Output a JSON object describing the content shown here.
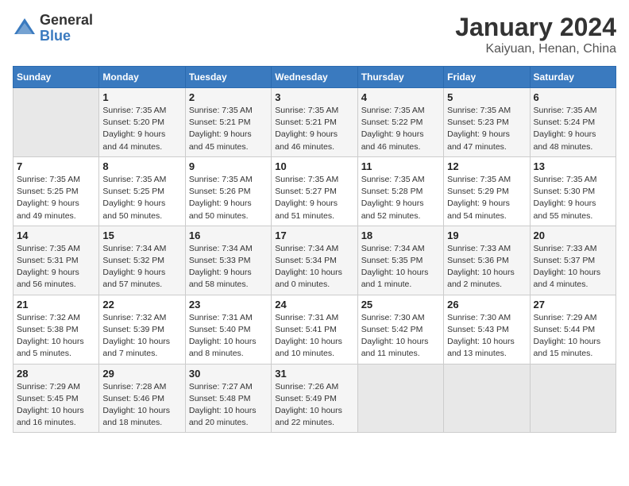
{
  "logo": {
    "general": "General",
    "blue": "Blue"
  },
  "title": "January 2024",
  "subtitle": "Kaiyuan, Henan, China",
  "days_header": [
    "Sunday",
    "Monday",
    "Tuesday",
    "Wednesday",
    "Thursday",
    "Friday",
    "Saturday"
  ],
  "weeks": [
    [
      {
        "num": "",
        "info": ""
      },
      {
        "num": "1",
        "info": "Sunrise: 7:35 AM\nSunset: 5:20 PM\nDaylight: 9 hours\nand 44 minutes."
      },
      {
        "num": "2",
        "info": "Sunrise: 7:35 AM\nSunset: 5:21 PM\nDaylight: 9 hours\nand 45 minutes."
      },
      {
        "num": "3",
        "info": "Sunrise: 7:35 AM\nSunset: 5:21 PM\nDaylight: 9 hours\nand 46 minutes."
      },
      {
        "num": "4",
        "info": "Sunrise: 7:35 AM\nSunset: 5:22 PM\nDaylight: 9 hours\nand 46 minutes."
      },
      {
        "num": "5",
        "info": "Sunrise: 7:35 AM\nSunset: 5:23 PM\nDaylight: 9 hours\nand 47 minutes."
      },
      {
        "num": "6",
        "info": "Sunrise: 7:35 AM\nSunset: 5:24 PM\nDaylight: 9 hours\nand 48 minutes."
      }
    ],
    [
      {
        "num": "7",
        "info": "Sunrise: 7:35 AM\nSunset: 5:25 PM\nDaylight: 9 hours\nand 49 minutes."
      },
      {
        "num": "8",
        "info": "Sunrise: 7:35 AM\nSunset: 5:25 PM\nDaylight: 9 hours\nand 50 minutes."
      },
      {
        "num": "9",
        "info": "Sunrise: 7:35 AM\nSunset: 5:26 PM\nDaylight: 9 hours\nand 50 minutes."
      },
      {
        "num": "10",
        "info": "Sunrise: 7:35 AM\nSunset: 5:27 PM\nDaylight: 9 hours\nand 51 minutes."
      },
      {
        "num": "11",
        "info": "Sunrise: 7:35 AM\nSunset: 5:28 PM\nDaylight: 9 hours\nand 52 minutes."
      },
      {
        "num": "12",
        "info": "Sunrise: 7:35 AM\nSunset: 5:29 PM\nDaylight: 9 hours\nand 54 minutes."
      },
      {
        "num": "13",
        "info": "Sunrise: 7:35 AM\nSunset: 5:30 PM\nDaylight: 9 hours\nand 55 minutes."
      }
    ],
    [
      {
        "num": "14",
        "info": "Sunrise: 7:35 AM\nSunset: 5:31 PM\nDaylight: 9 hours\nand 56 minutes."
      },
      {
        "num": "15",
        "info": "Sunrise: 7:34 AM\nSunset: 5:32 PM\nDaylight: 9 hours\nand 57 minutes."
      },
      {
        "num": "16",
        "info": "Sunrise: 7:34 AM\nSunset: 5:33 PM\nDaylight: 9 hours\nand 58 minutes."
      },
      {
        "num": "17",
        "info": "Sunrise: 7:34 AM\nSunset: 5:34 PM\nDaylight: 10 hours\nand 0 minutes."
      },
      {
        "num": "18",
        "info": "Sunrise: 7:34 AM\nSunset: 5:35 PM\nDaylight: 10 hours\nand 1 minute."
      },
      {
        "num": "19",
        "info": "Sunrise: 7:33 AM\nSunset: 5:36 PM\nDaylight: 10 hours\nand 2 minutes."
      },
      {
        "num": "20",
        "info": "Sunrise: 7:33 AM\nSunset: 5:37 PM\nDaylight: 10 hours\nand 4 minutes."
      }
    ],
    [
      {
        "num": "21",
        "info": "Sunrise: 7:32 AM\nSunset: 5:38 PM\nDaylight: 10 hours\nand 5 minutes."
      },
      {
        "num": "22",
        "info": "Sunrise: 7:32 AM\nSunset: 5:39 PM\nDaylight: 10 hours\nand 7 minutes."
      },
      {
        "num": "23",
        "info": "Sunrise: 7:31 AM\nSunset: 5:40 PM\nDaylight: 10 hours\nand 8 minutes."
      },
      {
        "num": "24",
        "info": "Sunrise: 7:31 AM\nSunset: 5:41 PM\nDaylight: 10 hours\nand 10 minutes."
      },
      {
        "num": "25",
        "info": "Sunrise: 7:30 AM\nSunset: 5:42 PM\nDaylight: 10 hours\nand 11 minutes."
      },
      {
        "num": "26",
        "info": "Sunrise: 7:30 AM\nSunset: 5:43 PM\nDaylight: 10 hours\nand 13 minutes."
      },
      {
        "num": "27",
        "info": "Sunrise: 7:29 AM\nSunset: 5:44 PM\nDaylight: 10 hours\nand 15 minutes."
      }
    ],
    [
      {
        "num": "28",
        "info": "Sunrise: 7:29 AM\nSunset: 5:45 PM\nDaylight: 10 hours\nand 16 minutes."
      },
      {
        "num": "29",
        "info": "Sunrise: 7:28 AM\nSunset: 5:46 PM\nDaylight: 10 hours\nand 18 minutes."
      },
      {
        "num": "30",
        "info": "Sunrise: 7:27 AM\nSunset: 5:48 PM\nDaylight: 10 hours\nand 20 minutes."
      },
      {
        "num": "31",
        "info": "Sunrise: 7:26 AM\nSunset: 5:49 PM\nDaylight: 10 hours\nand 22 minutes."
      },
      {
        "num": "",
        "info": ""
      },
      {
        "num": "",
        "info": ""
      },
      {
        "num": "",
        "info": ""
      }
    ]
  ]
}
